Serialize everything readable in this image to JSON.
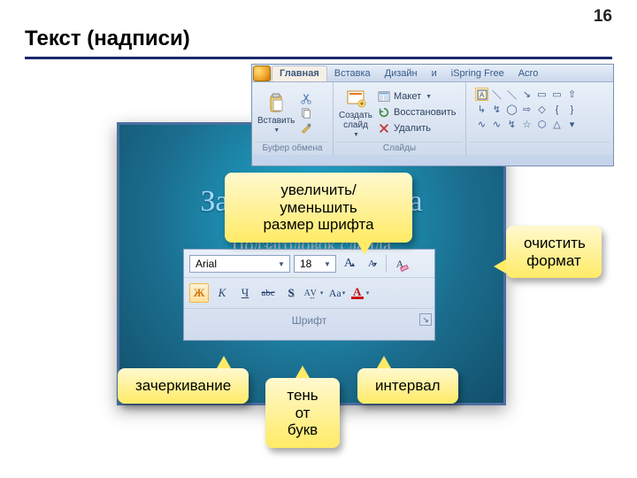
{
  "page_number": "16",
  "page_title": "Текст (надписи)",
  "slide": {
    "title": "Заголовок слайда",
    "subtitle": "Подзаголовок слайда"
  },
  "ribbon": {
    "tabs": [
      "Главная",
      "Вставка",
      "Дизайн",
      "и",
      "iSpring Free",
      "Acro"
    ],
    "active_tab_idx": 0,
    "office_icon": "office-icon",
    "groups": {
      "clipboard": {
        "label": "Буфер обмена",
        "paste_label": "Вставить",
        "cut_icon": "scissors-icon",
        "copy_icon": "copy-icon",
        "format_painter_icon": "paintbrush-icon"
      },
      "slides": {
        "label": "Слайды",
        "new_slide_label": "Создать\nслайд",
        "layout_label": "Макет",
        "reset_label": "Восстановить",
        "delete_label": "Удалить"
      }
    }
  },
  "font_toolbar": {
    "group_label": "Шрифт",
    "font_name": "Arial",
    "font_size": "18",
    "grow_font": "A",
    "shrink_font": "A",
    "clear_format_glyph": "Aa",
    "bold": "Ж",
    "italic": "К",
    "underline": "Ч",
    "strike": "abc",
    "shadow": "S",
    "spacing": "AV",
    "change_case": "Aa",
    "font_color": "A",
    "font_color_hex": "#cc1111"
  },
  "callouts": {
    "font_size": "увеличить/уменьшить\nразмер шрифта",
    "clear_format": "очистить\nформат",
    "strike": "зачеркивание",
    "shadow": "тень\nот букв",
    "spacing": "интервал"
  }
}
